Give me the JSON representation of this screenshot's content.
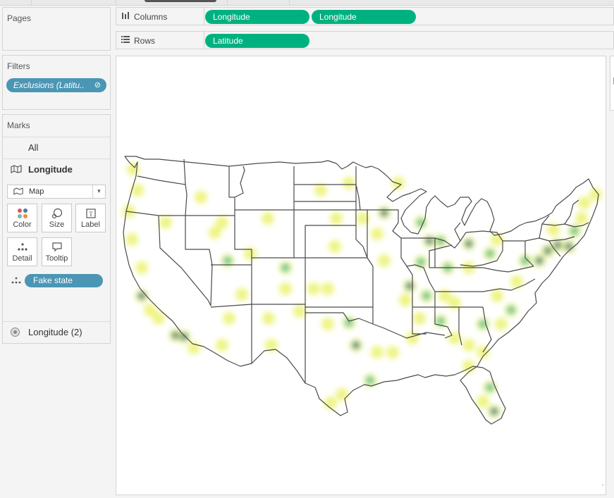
{
  "pages_card": {
    "title": "Pages"
  },
  "filters_card": {
    "title": "Filters",
    "pills": [
      {
        "label": "Exclusions (Latitu..",
        "icon": "link-icon"
      }
    ]
  },
  "marks_card": {
    "title": "Marks",
    "rows": [
      {
        "label": "All"
      },
      {
        "label": "Longitude",
        "icon": "map-icon"
      }
    ],
    "mark_type": {
      "value": "Map",
      "icon": "map-icon"
    },
    "buttons": [
      {
        "label": "Color",
        "icon": "color-dots-icon"
      },
      {
        "label": "Size",
        "icon": "size-icon"
      },
      {
        "label": "Label",
        "icon": "label-icon"
      },
      {
        "label": "Detail",
        "icon": "detail-dots-icon"
      },
      {
        "label": "Tooltip",
        "icon": "tooltip-icon"
      }
    ],
    "detail_pill": {
      "label": "Fake state"
    },
    "secondary_layer": {
      "label": "Longitude (2)"
    }
  },
  "columns_shelf": {
    "label": "Columns",
    "pills": [
      "Longitude",
      "Longitude"
    ]
  },
  "rows_shelf": {
    "label": "Rows",
    "pills": [
      "Latitude"
    ]
  },
  "view": {
    "type": "density map of the contiguous United States",
    "colors": {
      "low": "#e8f05a",
      "mid": "#3fb99b",
      "high": "#6b2f8c",
      "pill_green": "#00b180",
      "pill_blue": "#4b96b4"
    }
  }
}
